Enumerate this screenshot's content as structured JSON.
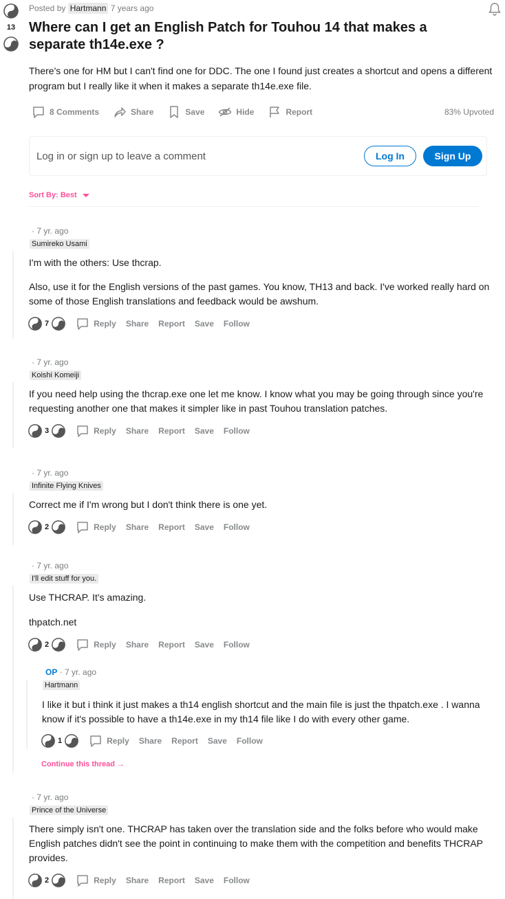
{
  "post": {
    "posted_by_prefix": "Posted by",
    "author": "Hartmann",
    "age": "7 years ago",
    "score": "13",
    "title": "Where can I get an English Patch for Touhou 14 that makes a separate th14e.exe ?",
    "body": "There's one for HM but I can't find one for DDC. The one I found just creates a shortcut and opens a different program but I really like it when it makes a separate th14e.exe file.",
    "actions": {
      "comments": "8 Comments",
      "share": "Share",
      "save": "Save",
      "hide": "Hide",
      "report": "Report"
    },
    "upvoted": "83% Upvoted"
  },
  "login_box": {
    "prompt": "Log in or sign up to leave a comment",
    "login_label": "Log In",
    "signup_label": "Sign Up"
  },
  "sort": {
    "label": "Sort By: Best"
  },
  "comment_actions": {
    "reply": "Reply",
    "share": "Share",
    "report": "Report",
    "save": "Save",
    "follow": "Follow"
  },
  "comments": [
    {
      "time": "· 7 yr. ago",
      "author": "Sumireko Usami",
      "paragraphs": [
        "I'm with the others: Use thcrap.",
        "Also, use it for the English versions of the past games. You know, TH13 and back. I've worked really hard on some of those English translations and feedback would be awshum."
      ],
      "score": "7"
    },
    {
      "time": "· 7 yr. ago",
      "author": "Koishi Komeiji",
      "paragraphs": [
        "If you need help using the thcrap.exe one let me know. I know what you may be going through since you're requesting another one that makes it simpler like in past Touhou translation patches."
      ],
      "score": "3"
    },
    {
      "time": "· 7 yr. ago",
      "author": "Infinite Flying Knives",
      "paragraphs": [
        "Correct me if I'm wrong but I don't think there is one yet."
      ],
      "score": "2"
    },
    {
      "time": "· 7 yr. ago",
      "author": "I'll edit stuff for you.",
      "paragraphs": [
        "Use THCRAP. It's amazing.",
        "thpatch.net"
      ],
      "score": "2"
    },
    {
      "op_tag": "OP",
      "time": "· 7 yr. ago",
      "author": "Hartmann",
      "paragraphs": [
        "I like it but i think it just makes a th14 english shortcut and the main file is just the thpatch.exe . I wanna know if it's possible to have a th14e.exe in my th14 file like I do with every other game."
      ],
      "score": "1",
      "continue_label": "Continue this thread"
    },
    {
      "time": "· 7 yr. ago",
      "author": "Prince of the Universe",
      "paragraphs": [
        "There simply isn't one. THCRAP has taken over the translation side and the folks before who would make English patches didn't see the point in continuing to make them with the competition and benefits THCRAP provides."
      ],
      "score": "2"
    }
  ],
  "colors": {
    "accent_pink": "#ff4f9a",
    "link_blue": "#0079d3",
    "muted": "#878a8c"
  }
}
